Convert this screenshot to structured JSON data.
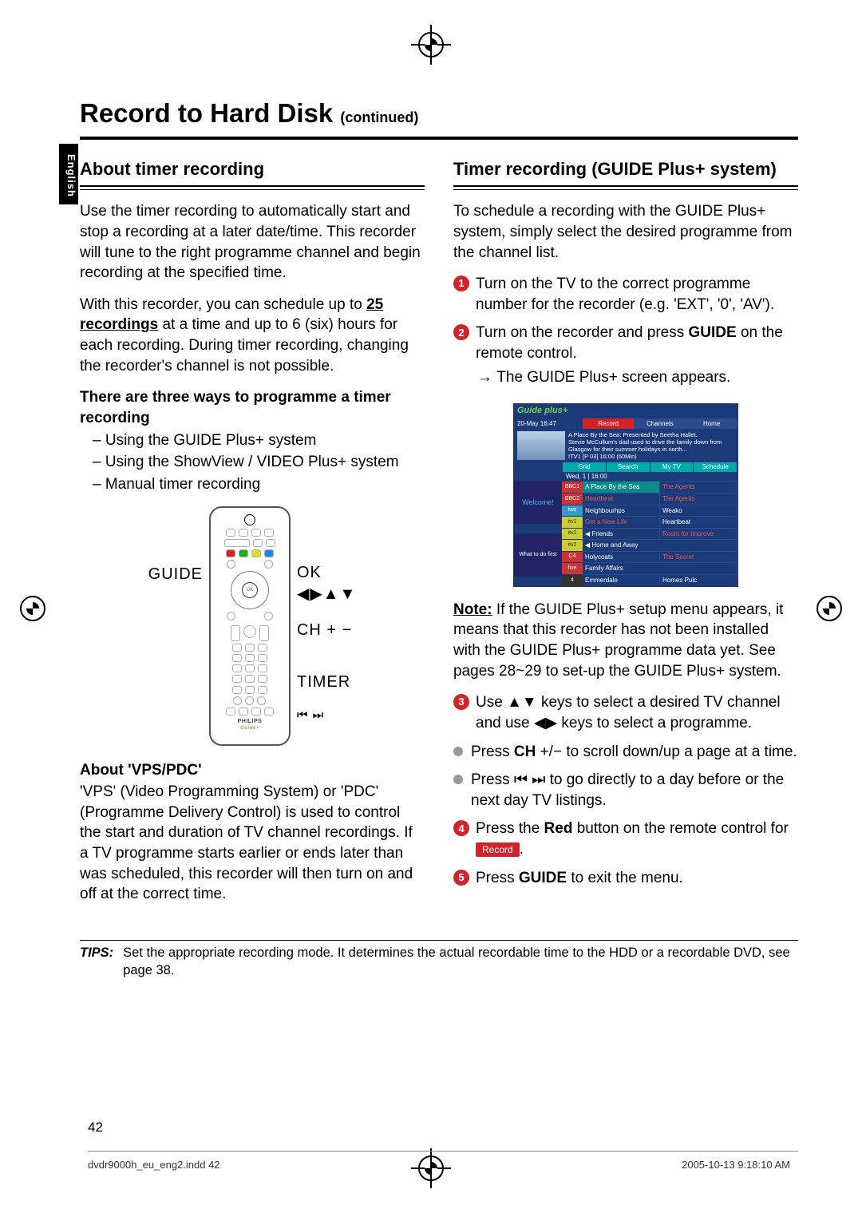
{
  "page_title": "Record to Hard Disk",
  "page_title_cont": "(continued)",
  "language_tab": "English",
  "left": {
    "heading_about_timer": "About timer recording",
    "para1": "Use the timer recording to automatically start and stop a recording at a later date/time. This recorder will tune to the right programme channel and begin recording at the specified time.",
    "para2_pre": "With this recorder, you can schedule up to ",
    "para2_bold": "25 recordings",
    "para2_post": " at a time and up to 6 (six) hours for each recording.  During timer recording, changing the recorder's channel is not possible.",
    "three_ways_heading": "There are three ways to programme a timer recording",
    "three_ways": [
      "Using the GUIDE Plus+ system",
      "Using the ShowView / VIDEO Plus+ system",
      "Manual timer recording"
    ],
    "remote_labels": {
      "guide": "GUIDE",
      "ok": "OK",
      "arrows": "◀▶▲▼",
      "ch": "CH + −",
      "timer": "TIMER",
      "skip": "⏮ ⏭"
    },
    "vps_heading": "About 'VPS/PDC'",
    "vps_body": "'VPS' (Video Programming System) or 'PDC' (Programme Delivery Control) is used to control the start and duration of TV channel recordings. If a TV programme starts earlier or ends later than was scheduled, this recorder will then turn on and off at the correct time."
  },
  "right": {
    "heading_timer_guide": "Timer recording (GUIDE Plus+ system)",
    "intro": "To schedule a recording with the GUIDE Plus+ system, simply select the desired programme from the channel list.",
    "step1": "Turn on the TV to the correct programme number for the recorder (e.g. 'EXT', '0', 'AV').",
    "step2_pre": "Turn on the recorder and press ",
    "step2_bold": "GUIDE",
    "step2_post": " on the remote control.",
    "step2_result": "The GUIDE Plus+ screen appears.",
    "note_label": "Note:",
    "note_body": " If the GUIDE Plus+ setup menu appears, it means that this recorder has not been installed with the GUIDE Plus+ programme data yet. See pages 28~29 to set-up the GUIDE Plus+ system.",
    "step3": "Use ▲▼ keys to select a desired TV channel and use ◀▶ keys to select a programme.",
    "bullet1_pre": "Press ",
    "bullet1_bold": "CH",
    "bullet1_post": " +/− to scroll down/up a page at a time.",
    "bullet2": "Press ⏮ ⏭ to go directly to a day before or the next day TV listings.",
    "step4_pre": "Press the ",
    "step4_bold": "Red",
    "step4_post": " button on the remote control for ",
    "step4_badge": "Record",
    "step4_end": ".",
    "step5_pre": "Press ",
    "step5_bold": "GUIDE",
    "step5_post": " to exit the menu."
  },
  "guide_screenshot": {
    "brand": "Guide plus+",
    "date": "20-May  16:47",
    "tabs": [
      "Record",
      "Channels",
      "Home"
    ],
    "prog_title": "A Place By the Sea: Presented by Seetha Hallet.",
    "prog_desc": "Stevie McCullum's dad used to drive the family down from Glasgow for their summer holidays in north...",
    "channel_info": "ITV1    [P 03]    16:00 (60Min)",
    "grid_tabs": [
      "Grid",
      "Search",
      "My TV",
      "Schedule"
    ],
    "time_header": "Wed, 1 | 16:00",
    "rows": [
      {
        "ch": "BBC1",
        "p1": "A Place By the Sea",
        "p2": "The Agents"
      },
      {
        "ch": "BBC2",
        "p1": "Heartbeat",
        "p2": "The Agents"
      },
      {
        "ch": "two",
        "p1": "Neighbourhps",
        "p2": "Weako"
      },
      {
        "ch": "itv1",
        "p1": "Get a New Life",
        "p2": "Heartbeat"
      },
      {
        "ch": "itv2",
        "p1": "◀ Friends",
        "p2": "Room for Improve"
      },
      {
        "ch": "itv2",
        "p1": "◀ Home and Away",
        "p2": ""
      },
      {
        "ch": "C4",
        "p1": "Holycoats",
        "p2": "The Secret"
      },
      {
        "ch": "five",
        "p1": "Family Affairs",
        "p2": ""
      },
      {
        "ch": "4",
        "p1": "Emmerdale",
        "p2": "Homes    Pulc"
      }
    ],
    "ads": [
      "Welcome!",
      "What to do first"
    ]
  },
  "tips_label": "TIPS:",
  "tips_body": "Set the appropriate recording mode. It determines the actual recordable time to the HDD or a recordable DVD, see page 38.",
  "page_number": "42",
  "footer_left": "dvdr9000h_eu_eng2.indd   42",
  "footer_right": "2005-10-13   9:18:10 AM"
}
